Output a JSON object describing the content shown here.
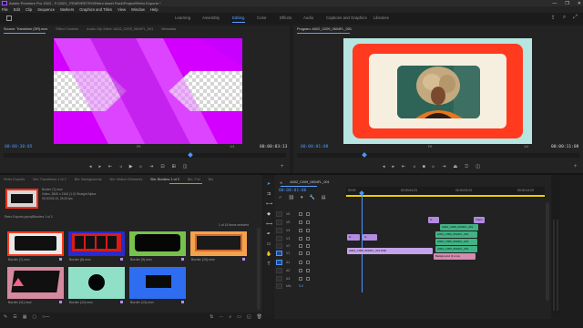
{
  "window": {
    "title": "Adobe Premiere Pro 2022 - F:\\2021_ITEMS\\RETRO\\Retro Asset Pack\\Project\\Retro Exports *",
    "controls": [
      "—",
      "❐",
      "✕"
    ]
  },
  "menu": [
    "File",
    "Edit",
    "Clip",
    "Sequence",
    "Markers",
    "Graphics and Titles",
    "View",
    "Window",
    "Help"
  ],
  "workspaces": {
    "tabs": [
      "Learning",
      "Assembly",
      "Editing",
      "Color",
      "Effects",
      "Audio",
      "Captions and Graphics",
      "Libraries"
    ],
    "active": "Editing"
  },
  "source_panel": {
    "tabs": [
      "Source: Transform (SR).mov",
      "Effect Controls",
      "Audio Clip Mixer: A002_C009_0604FL_001",
      "Metadata"
    ],
    "timecode_in": "00:00:30:05",
    "fit": "Fit",
    "scale": "1/4",
    "timecode_dur": "00:00:03:13"
  },
  "program_panel": {
    "tab": "Program: A002_C009_0604FL_001",
    "timecode_in": "00:00:01:08",
    "fit": "Fit",
    "scale": "1/4",
    "timecode_dur": "00:00:11:08"
  },
  "project_panel": {
    "tabs": [
      "Retro Exports",
      "Bin: Transitions 1 of 2",
      "Bin: Backgrounds",
      "Bin: Motion Elements",
      "Bin: Borders 1 of 2",
      "Bin: Full",
      "Bin"
    ],
    "active_tab": "Bin: Borders 1 of 2",
    "preview_name": "Border (7).mov",
    "preview_info": "Video, 3840 x 2160 (1.0) Straight Alpha",
    "preview_duration": "00:00:05:13, 25.00 fps",
    "path": "Retro Exports.prproj\\Borders 1 of 2",
    "item_count": "1 of 15 items selected",
    "thumbs": [
      {
        "name": "Border (7).mov",
        "selected": true
      },
      {
        "name": "Border (8).mov",
        "selected": false
      },
      {
        "name": "Border (9).mov",
        "selected": false
      },
      {
        "name": "Border (10).mov",
        "selected": false
      },
      {
        "name": "Border (11).mov",
        "selected": false
      },
      {
        "name": "Border (12).mov",
        "selected": false
      },
      {
        "name": "Border (13).mov",
        "selected": false
      }
    ]
  },
  "timeline": {
    "sequence": "A002_C009_0604FL_001",
    "timecode": "00:00:01:06",
    "ruler": [
      "00:00",
      "00:00:04:23",
      "00:00:09:23",
      "00:00:14:23"
    ],
    "tracks": [
      {
        "label": "V6"
      },
      {
        "label": "V5"
      },
      {
        "label": "V4"
      },
      {
        "label": "V3"
      },
      {
        "label": "V2"
      },
      {
        "label": "V1"
      },
      {
        "label": "A1"
      },
      {
        "label": "A2"
      },
      {
        "label": "A3"
      },
      {
        "label": "Mix"
      }
    ],
    "mix_value": "0.0",
    "clips": {
      "c1": "fx",
      "c2": "Trans",
      "c3": "A002_C009_0604FL_001",
      "c4": "A002_C009_0604FL_001",
      "c5": "A002_C009_0604FL_001",
      "c6": "A002_C009_0604FL_001",
      "c7": "Background (1).mov",
      "c8": "fx",
      "c9": "A002_C009_0604FL_001.R3D",
      "c10": "fx"
    }
  },
  "colors": {
    "accent": "#4c97ff",
    "purple_clip": "#b38be0",
    "green_clip": "#42b386",
    "magenta": "#d400ff"
  }
}
